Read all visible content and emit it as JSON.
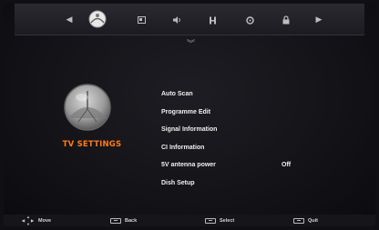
{
  "menu": {
    "category_title": "TV SETTINGS",
    "items": [
      {
        "label": "Auto Scan",
        "value": ""
      },
      {
        "label": "Programme Edit",
        "value": ""
      },
      {
        "label": "Signal Information",
        "value": ""
      },
      {
        "label": "CI Information",
        "value": ""
      },
      {
        "label": "5V antenna power",
        "value": "Off"
      },
      {
        "label": "Dish Setup",
        "value": ""
      }
    ]
  },
  "top_icons": [
    "tv-settings-icon",
    "picture-icon",
    "sound-icon",
    "timer-icon",
    "settings-icon",
    "lock-icon",
    "input-icon"
  ],
  "footer": {
    "move": "Move",
    "back": "Back",
    "select": "Select",
    "quit": "Quit"
  },
  "colors": {
    "accent": "#ff7a1a",
    "text": "#f0f0f0",
    "background": "#111115"
  }
}
